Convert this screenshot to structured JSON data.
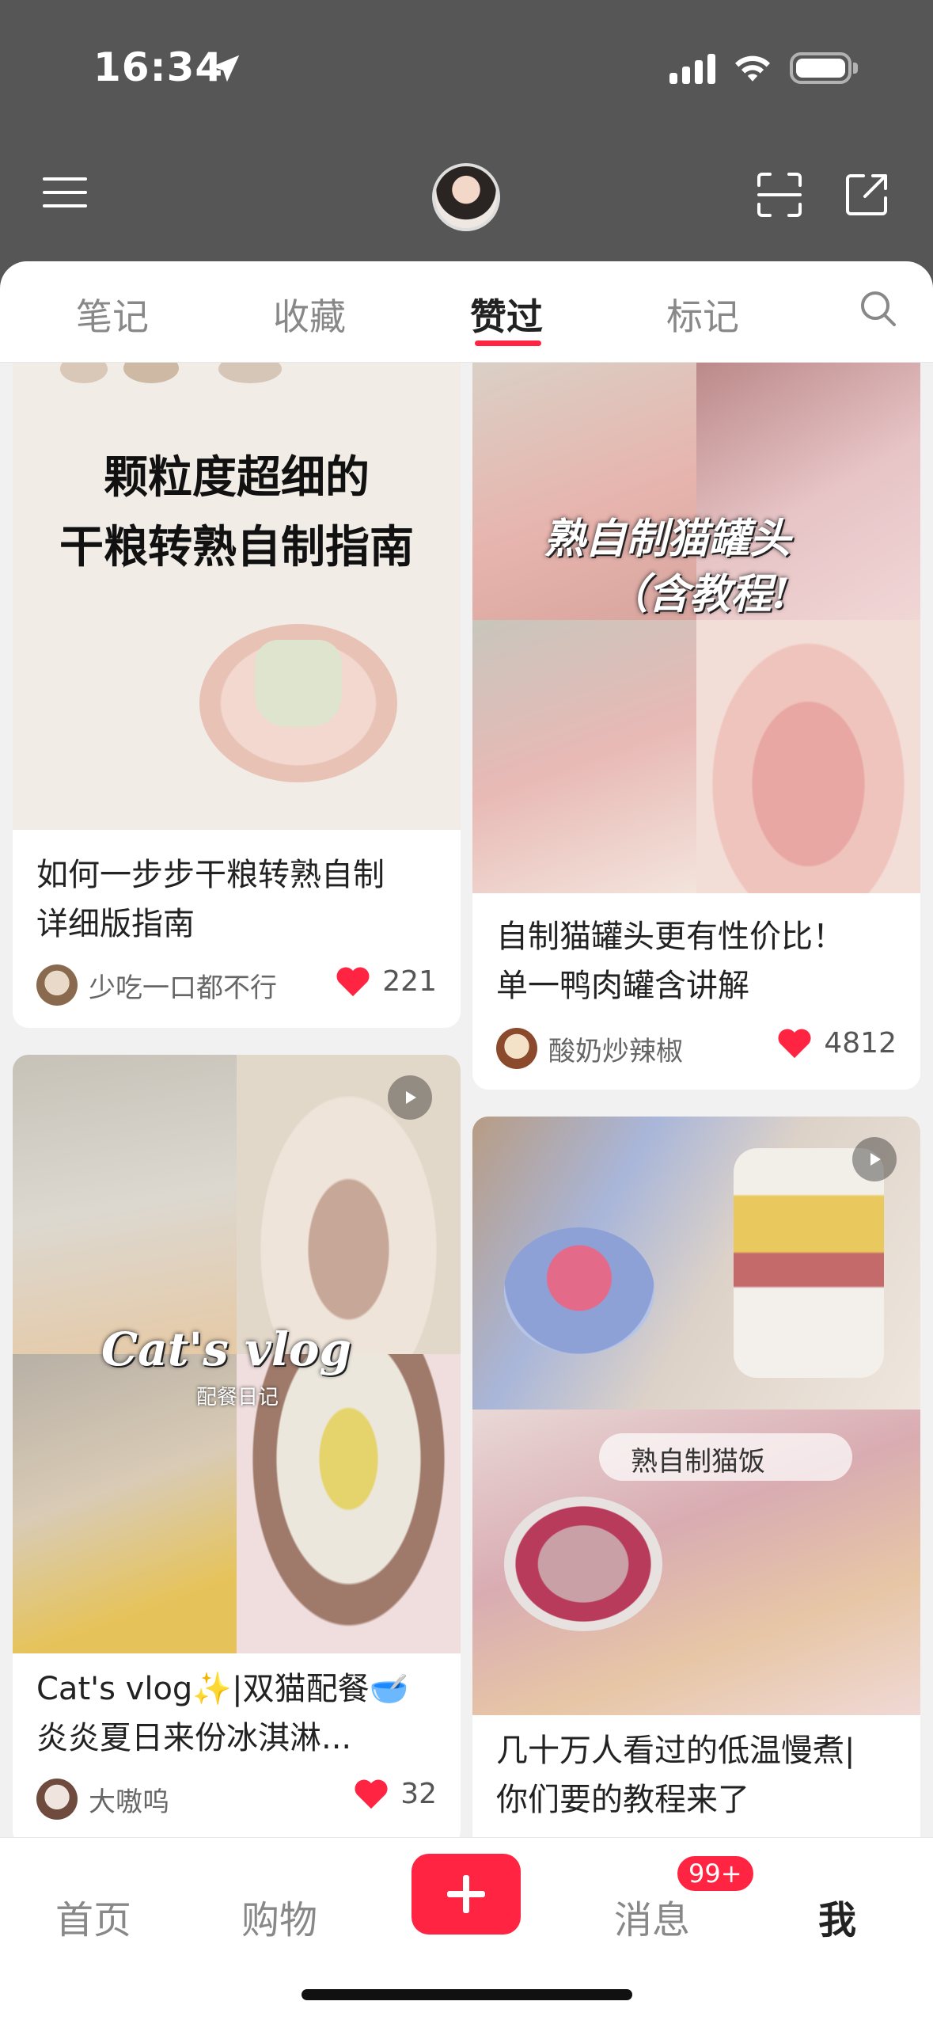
{
  "status_bar": {
    "time": "16:34"
  },
  "tabs": [
    {
      "label": "笔记"
    },
    {
      "label": "收藏"
    },
    {
      "label": "赞过"
    },
    {
      "label": "标记"
    }
  ],
  "active_tab": "赞过",
  "notes": [
    {
      "image_caption_line1": "颗粒度超细的",
      "image_caption_line2": "干粮转熟自制指南",
      "title_line1": "如何一步步干粮转熟自制",
      "title_line2": "详细版指南",
      "author": "少吃一口都不行",
      "likes": "221"
    },
    {
      "image_caption_line1": "熟自制猫罐头",
      "image_caption_line2": "（含教程!",
      "title_line1": "自制猫罐头更有性价比！",
      "title_line2": "单一鸭肉罐含讲解",
      "author": "酸奶炒辣椒",
      "likes": "4812"
    },
    {
      "image_caption_line1": "Cat's vlog",
      "image_caption_line2": "配餐日记",
      "title_line1": "Cat's vlog✨|双猫配餐🥣",
      "title_line2": "炎炎夏日来份冰淇淋...",
      "author": "大嗷呜",
      "likes": "32"
    },
    {
      "image_caption_line1": "熟自制猫饭",
      "title_line1": "几十万人看过的低温慢煮|",
      "title_line2": "你们要的教程来了"
    }
  ],
  "bottom_nav": {
    "home": "首页",
    "shop": "购物",
    "messages": "消息",
    "messages_badge": "99+",
    "me": "我"
  },
  "colors": {
    "accent": "#ff2442",
    "header_bg": "#565656"
  },
  "icons": [
    "location-arrow-icon",
    "signal-icon",
    "wifi-icon",
    "battery-icon",
    "menu-icon",
    "scan-icon",
    "share-icon",
    "search-icon",
    "heart-icon",
    "play-icon",
    "plus-icon"
  ]
}
